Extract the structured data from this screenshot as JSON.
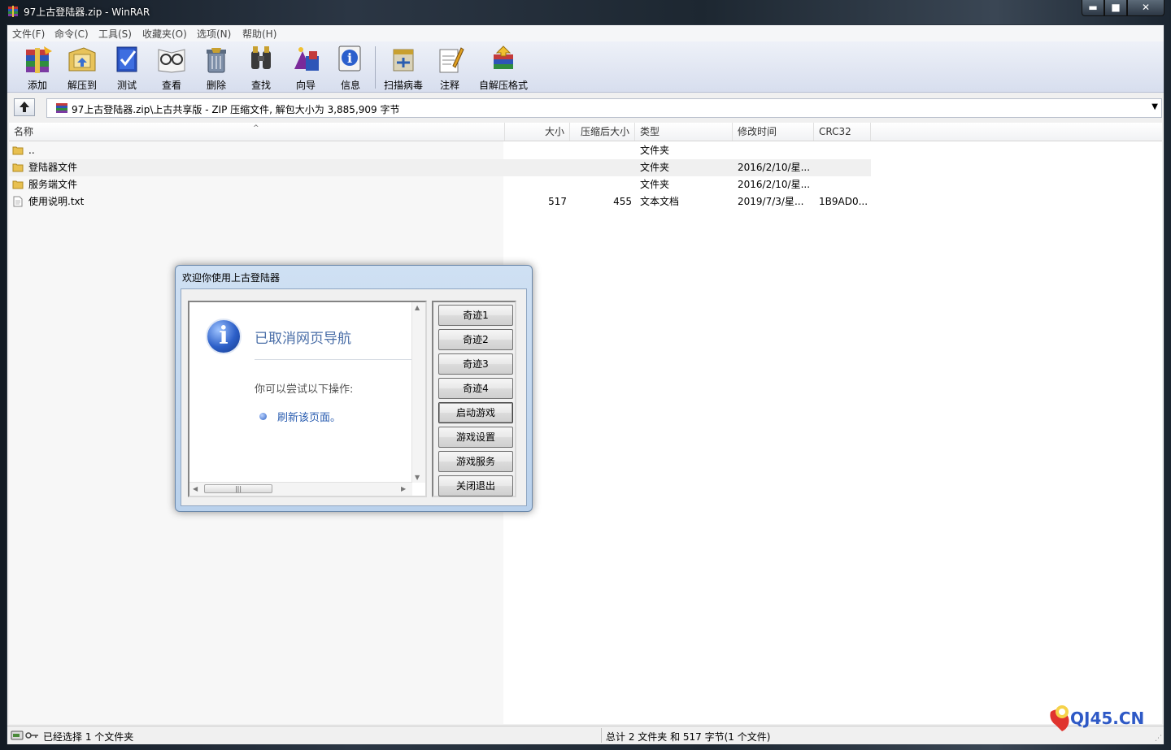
{
  "window": {
    "title": "97上古登陆器.zip - WinRAR",
    "controls": {
      "minimize": "▬",
      "maximize": "■",
      "close": "✕"
    }
  },
  "menu": [
    "文件(F)",
    "命令(C)",
    "工具(S)",
    "收藏夹(O)",
    "选项(N)",
    "帮助(H)"
  ],
  "toolbar": [
    {
      "label": "添加",
      "icon": "add-archive-icon"
    },
    {
      "label": "解压到",
      "icon": "extract-to-icon"
    },
    {
      "label": "测试",
      "icon": "test-icon"
    },
    {
      "label": "查看",
      "icon": "view-icon"
    },
    {
      "label": "删除",
      "icon": "delete-icon"
    },
    {
      "label": "查找",
      "icon": "find-icon"
    },
    {
      "label": "向导",
      "icon": "wizard-icon"
    },
    {
      "label": "信息",
      "icon": "info-icon"
    },
    {
      "label": "扫描病毒",
      "icon": "virus-scan-icon"
    },
    {
      "label": "注释",
      "icon": "comment-icon"
    },
    {
      "label": "自解压格式",
      "icon": "sfx-icon"
    }
  ],
  "address": {
    "path": "97上古登陆器.zip\\上古共享版 - ZIP 压缩文件, 解包大小为 3,885,909 字节",
    "dropdown": "▼"
  },
  "columns": [
    "名称",
    "大小",
    "压缩后大小",
    "类型",
    "修改时间",
    "CRC32"
  ],
  "sort_indicator": "^",
  "files": [
    {
      "name": "..",
      "size": "",
      "packed": "",
      "type": "文件夹",
      "modified": "",
      "crc": "",
      "kind": "folder"
    },
    {
      "name": "登陆器文件",
      "size": "",
      "packed": "",
      "type": "文件夹",
      "modified": "2016/2/10/星...",
      "crc": "",
      "kind": "folder"
    },
    {
      "name": "服务端文件",
      "size": "",
      "packed": "",
      "type": "文件夹",
      "modified": "2016/2/10/星...",
      "crc": "",
      "kind": "folder"
    },
    {
      "name": "使用说明.txt",
      "size": "517",
      "packed": "455",
      "type": "文本文档",
      "modified": "2019/7/3/星...",
      "crc": "1B9AD0...",
      "kind": "file"
    }
  ],
  "status": {
    "left": "已经选择 1 个文件夹",
    "right": "总计 2 文件夹 和 517 字节(1 个文件)"
  },
  "dialog": {
    "title": "欢迎你使用上古登陆器",
    "nav_title": "已取消网页导航",
    "hint": "你可以尝试以下操作:",
    "refresh_link": "刷新该页面。",
    "info_glyph": "i",
    "scroll_thumb": "|||",
    "buttons": [
      "奇迹1",
      "奇迹2",
      "奇迹3",
      "奇迹4",
      "启动游戏",
      "游戏设置",
      "游戏服务",
      "关闭退出"
    ]
  },
  "watermark": {
    "text": "QJ45.CN"
  },
  "colors": {
    "accent": "#2a5db0",
    "toolbar_bg": "#d7deee",
    "dialog_border": "#6b88aa"
  }
}
